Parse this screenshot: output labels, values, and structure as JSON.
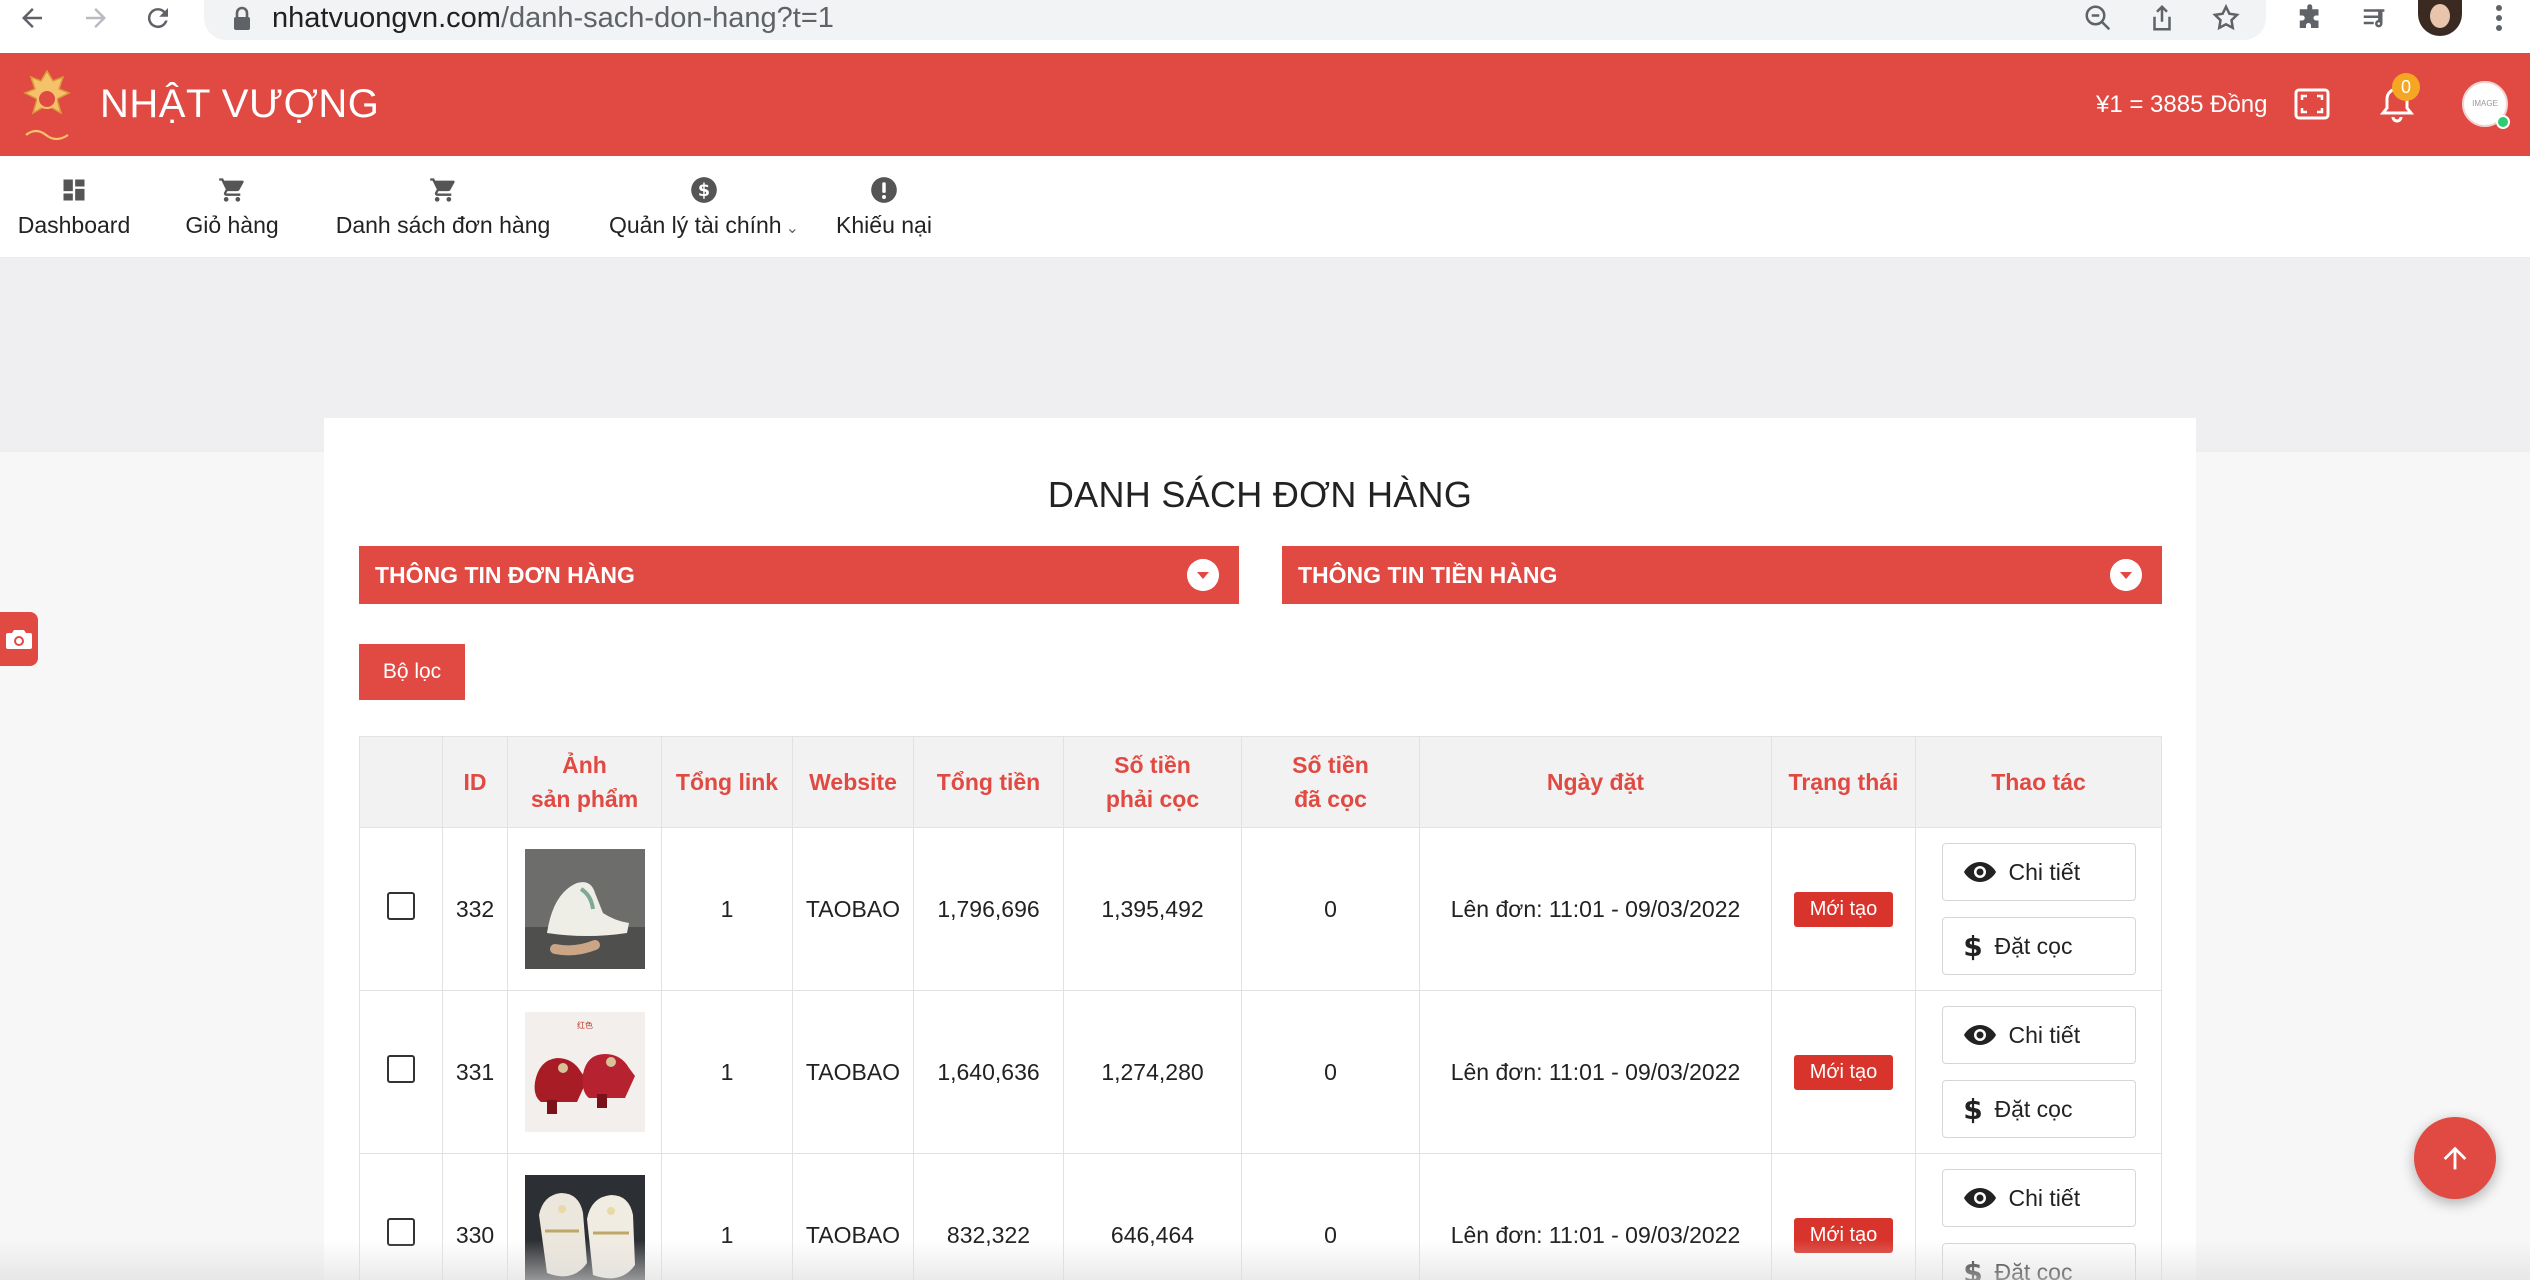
{
  "browser": {
    "url_domain": "nhatvuongvn.com",
    "url_path": "/danh-sach-don-hang?t=1"
  },
  "header": {
    "brand": "NHẬT VƯỢNG",
    "rate": "¥1 = 3885 Đồng",
    "notification_count": "0",
    "avatar_text": "IMAGE"
  },
  "nav": {
    "items": [
      {
        "label": "Dashboard",
        "icon": "dashboard-icon"
      },
      {
        "label": "Giỏ hàng",
        "icon": "cart-icon"
      },
      {
        "label": "Danh sách đơn hàng",
        "icon": "cart-icon"
      },
      {
        "label": "Quản lý tài chính",
        "icon": "dollar-circle-icon"
      },
      {
        "label": "Khiếu nại",
        "icon": "alert-circle-icon"
      }
    ]
  },
  "main": {
    "title": "DANH SÁCH ĐƠN HÀNG",
    "panel_order_info": "THÔNG TIN ĐƠN HÀNG",
    "panel_money_info": "THÔNG TIN TIỀN HÀNG",
    "filter_label": "Bộ lọc"
  },
  "table": {
    "headers": {
      "id": "ID",
      "image_line1": "Ảnh",
      "image_line2": "sản phẩm",
      "total_links": "Tổng link",
      "website": "Website",
      "total": "Tổng tiền",
      "deposit_required_line1": "Số tiền",
      "deposit_required_line2": "phải cọc",
      "deposit_paid_line1": "Số tiền",
      "deposit_paid_line2": "đã cọc",
      "date": "Ngày đặt",
      "status": "Trạng thái",
      "actions": "Thao tác"
    },
    "rows": [
      {
        "id": "332",
        "links": "1",
        "website": "TAOBAO",
        "total": "1,796,696",
        "required": "1,395,492",
        "paid": "0",
        "date": "Lên đơn: 11:01 - 09/03/2022",
        "status": "Mới tạo"
      },
      {
        "id": "331",
        "links": "1",
        "website": "TAOBAO",
        "total": "1,640,636",
        "required": "1,274,280",
        "paid": "0",
        "date": "Lên đơn: 11:01 - 09/03/2022",
        "status": "Mới tạo"
      },
      {
        "id": "330",
        "links": "1",
        "website": "TAOBAO",
        "total": "832,322",
        "required": "646,464",
        "paid": "0",
        "date": "Lên đơn: 11:01 - 09/03/2022",
        "status": "Mới tạo"
      }
    ],
    "action_detail": "Chi tiết",
    "action_deposit": "Đặt cọc"
  },
  "colors": {
    "brand_red": "#e04a42",
    "status_red": "#d9342b",
    "badge_orange": "#f5a623"
  }
}
